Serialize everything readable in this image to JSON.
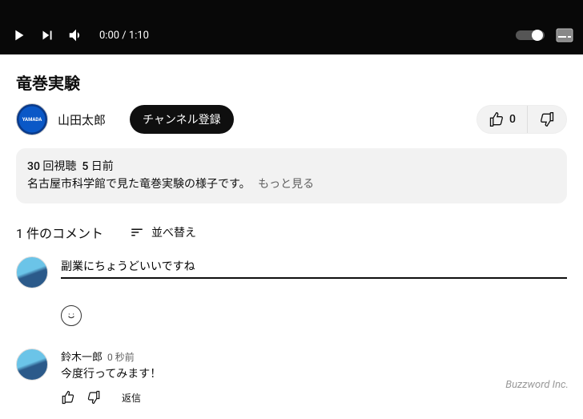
{
  "player": {
    "current_time": "0:00",
    "duration": "1:10"
  },
  "video": {
    "title": "竜巻実験"
  },
  "channel": {
    "avatar_text": "YAMADA",
    "name": "山田太郎",
    "subscribe_label": "チャンネル登録"
  },
  "actions": {
    "like_count": "0"
  },
  "description": {
    "views": "30 回視聴",
    "age": "5 日前",
    "text": "名古屋市科学館で見た竜巻実験の様子です。",
    "more_label": "もっと見る"
  },
  "comments": {
    "count_label": "1 件のコメント",
    "sort_label": "並べ替え",
    "input_value": "副業にちょうどいいですね"
  },
  "comment_list": [
    {
      "author": "鈴木一郎",
      "time": "0 秒前",
      "text": "今度行ってみます！",
      "reply_label": "返信"
    }
  ],
  "watermark": "Buzzword Inc."
}
